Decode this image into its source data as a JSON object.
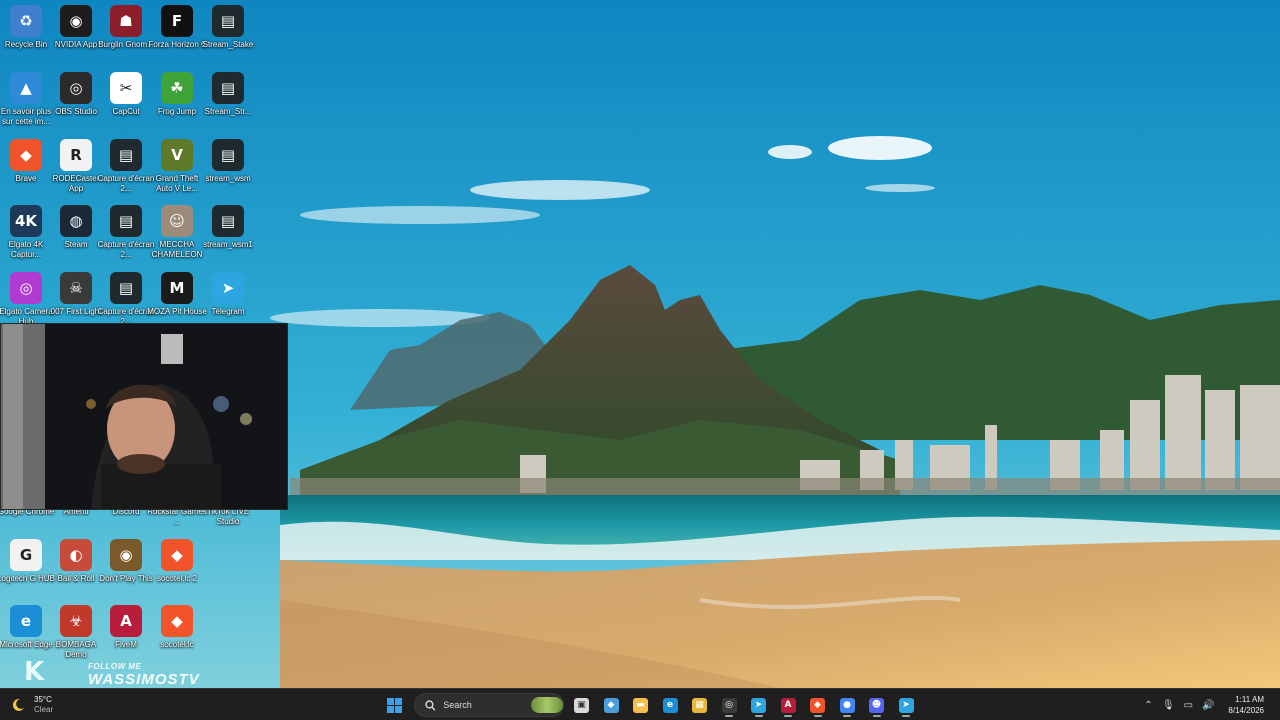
{
  "desktop_icons": [
    {
      "label": "Recycle Bin",
      "icon": "recycle-bin-icon",
      "color": "#3f7fcf",
      "glyph": "♻"
    },
    {
      "label": "NVIDIA App",
      "icon": "nvidia-icon",
      "color": "#1d1d1d",
      "glyph": "◉"
    },
    {
      "label": "Burglin Gnom...",
      "icon": "burglin-gnomes-icon",
      "color": "#8b1e2a",
      "glyph": "☗"
    },
    {
      "label": "Forza Horizon 6",
      "icon": "forza-icon",
      "color": "#111111",
      "glyph": "F"
    },
    {
      "label": "Stream_Stake",
      "icon": "video-file-icon",
      "color": "#1e2a2e",
      "glyph": "▤"
    },
    {
      "label": "En savoir plus sur cette im...",
      "icon": "spotlight-icon",
      "color": "#2d8ad7",
      "glyph": "▲"
    },
    {
      "label": "OBS Studio",
      "icon": "obs-icon",
      "color": "#2b2b2b",
      "glyph": "◎"
    },
    {
      "label": "CapCut",
      "icon": "capcut-icon",
      "color": "#ffffff",
      "glyph": "✂"
    },
    {
      "label": "Frog Jump",
      "icon": "frog-jump-icon",
      "color": "#3fa33a",
      "glyph": "☘"
    },
    {
      "label": "Stream_Str...",
      "icon": "video-file-icon",
      "color": "#1e2a2e",
      "glyph": "▤"
    },
    {
      "label": "Brave",
      "icon": "brave-icon",
      "color": "#f1542b",
      "glyph": "◆"
    },
    {
      "label": "RODECaster App",
      "icon": "rodecaster-icon",
      "color": "#f2f2f2",
      "glyph": "R"
    },
    {
      "label": "Capture d'écran 2...",
      "icon": "screenshot-file-icon",
      "color": "#1e2a2e",
      "glyph": "▤"
    },
    {
      "label": "Grand Theft Auto V Le...",
      "icon": "gta-icon",
      "color": "#5e7a2a",
      "glyph": "V"
    },
    {
      "label": "stream_wsm",
      "icon": "video-file-icon",
      "color": "#1e2a2e",
      "glyph": "▤"
    },
    {
      "label": "Elgato 4K Captur...",
      "icon": "elgato-4k-icon",
      "color": "#1e3a5a",
      "glyph": "4K"
    },
    {
      "label": "Steam",
      "icon": "steam-icon",
      "color": "#1b2838",
      "glyph": "◍"
    },
    {
      "label": "Capture d'écran 2...",
      "icon": "screenshot-file-icon",
      "color": "#1e2a2e",
      "glyph": "▤"
    },
    {
      "label": "MECCHA CHAMELEON",
      "icon": "meccha-chameleon-icon",
      "color": "#9c8a7a",
      "glyph": "☺"
    },
    {
      "label": "stream_wsm1",
      "icon": "video-file-icon",
      "color": "#1e2a2e",
      "glyph": "▤"
    },
    {
      "label": "Elgato Camera Hub",
      "icon": "elgato-camera-hub-icon",
      "color": "#b03bd1",
      "glyph": "◎"
    },
    {
      "label": "007 First Light",
      "icon": "007-first-light-icon",
      "color": "#3a3a3a",
      "glyph": "☠"
    },
    {
      "label": "Capture d'écran 2...",
      "icon": "screenshot-file-icon",
      "color": "#1e2a2e",
      "glyph": "▤"
    },
    {
      "label": "MOZA Pit House",
      "icon": "moza-icon",
      "color": "#1a1a1a",
      "glyph": "M"
    },
    {
      "label": "Telegram",
      "icon": "telegram-icon",
      "color": "#2ca5e0",
      "glyph": "➤"
    },
    {
      "label": "Google Chrome",
      "icon": "chrome-icon",
      "color": "#4285f4",
      "glyph": "●"
    },
    {
      "label": "Amenti",
      "icon": "amenti-icon",
      "color": "#5a4a3a",
      "glyph": "A"
    },
    {
      "label": "Discord",
      "icon": "discord-icon",
      "color": "#5865f2",
      "glyph": "☻"
    },
    {
      "label": "Rockstar Games ...",
      "icon": "rockstar-icon",
      "color": "#f5a623",
      "glyph": "R"
    },
    {
      "label": "TikTok LIVE Studio",
      "icon": "tiktok-live-icon",
      "color": "#111111",
      "glyph": "♪"
    },
    {
      "label": "Logitech G HUB",
      "icon": "logitech-ghub-icon",
      "color": "#f2f2f2",
      "glyph": "G"
    },
    {
      "label": "Ball & Roll",
      "icon": "ball-and-roll-icon",
      "color": "#c74b3a",
      "glyph": "◐"
    },
    {
      "label": "Don't Play This",
      "icon": "dont-play-this-icon",
      "color": "#7a5a2a",
      "glyph": "◉"
    },
    {
      "label": "socotel.lc 2",
      "icon": "brave-profile-icon",
      "color": "#f1542b",
      "glyph": "◆"
    },
    {
      "label": "Microsoft Edge",
      "icon": "edge-icon",
      "color": "#1b8ed6",
      "glyph": "e"
    },
    {
      "label": "BOMBAGA Demo",
      "icon": "bombaga-icon",
      "color": "#c0392b",
      "glyph": "☣"
    },
    {
      "label": "FiveM",
      "icon": "fivem-icon",
      "color": "#b81e3c",
      "glyph": "A"
    },
    {
      "label": "socotel.lc",
      "icon": "brave-profile-icon",
      "color": "#f1542b",
      "glyph": "◆"
    }
  ],
  "watermark": {
    "follow": "FOLLOW ME",
    "handle": "WASSIMOSTV",
    "logo": "K"
  },
  "taskbar": {
    "weather": {
      "temp": "35°C",
      "condition": "Clear"
    },
    "search_placeholder": "Search",
    "pinned": [
      {
        "name": "start-button",
        "icon": "windows-icon",
        "color": "#2f8fe6",
        "glyph": ""
      },
      {
        "name": "task-view-button",
        "icon": "task-view-icon",
        "color": "#d9d9d9",
        "glyph": "▣"
      },
      {
        "name": "widgets-button",
        "icon": "widgets-icon",
        "color": "#4a9edb",
        "glyph": "◆"
      },
      {
        "name": "file-explorer-button",
        "icon": "folder-icon",
        "color": "#f3c14b",
        "glyph": "▬"
      },
      {
        "name": "edge-taskbar-button",
        "icon": "edge-icon",
        "color": "#1b8ed6",
        "glyph": "e"
      },
      {
        "name": "store-taskbar-button",
        "icon": "store-icon",
        "color": "#e8b83a",
        "glyph": "▦"
      },
      {
        "name": "obs-taskbar-button",
        "icon": "obs-icon",
        "color": "#3a3a3a",
        "glyph": "◎"
      },
      {
        "name": "telegram-taskbar-button",
        "icon": "telegram-icon",
        "color": "#2ca5e0",
        "glyph": "➤"
      },
      {
        "name": "fivem-taskbar-button",
        "icon": "fivem-icon",
        "color": "#b81e3c",
        "glyph": "A"
      },
      {
        "name": "brave-taskbar-button",
        "icon": "brave-icon",
        "color": "#f1542b",
        "glyph": "◆"
      },
      {
        "name": "chrome-taskbar-button",
        "icon": "chrome-icon",
        "color": "#4285f4",
        "glyph": "●"
      },
      {
        "name": "discord-taskbar-button",
        "icon": "discord-icon",
        "color": "#5865f2",
        "glyph": "☻"
      },
      {
        "name": "telegram-2-taskbar-button",
        "icon": "telegram-icon",
        "color": "#2ca5e0",
        "glyph": "➤"
      }
    ],
    "tray": {
      "time": "1:11 AM",
      "date": "8/14/2026"
    }
  }
}
